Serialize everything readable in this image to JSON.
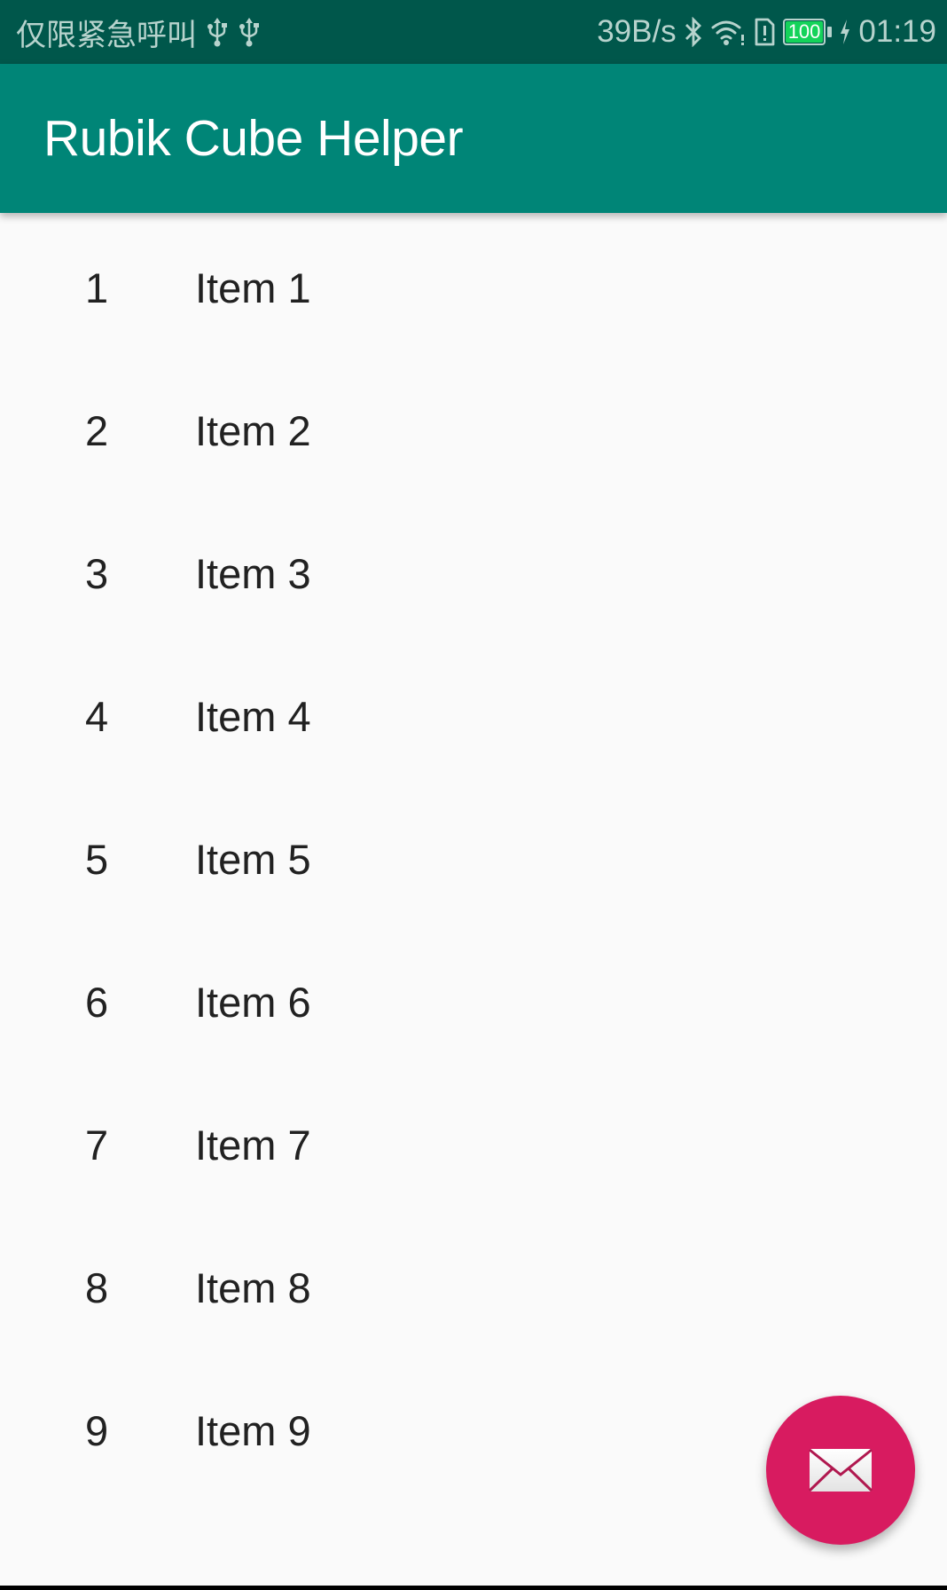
{
  "status_bar": {
    "carrier_text": "仅限紧急呼叫",
    "left_icons": [
      "usb-icon",
      "usb-icon"
    ],
    "network_speed": "39B/s",
    "right_icons": [
      "bluetooth-icon",
      "wifi-icon",
      "sim-alert-icon"
    ],
    "battery_level": "100",
    "charging": true,
    "time": "01:19"
  },
  "app_bar": {
    "title": "Rubik Cube Helper"
  },
  "list": {
    "items": [
      {
        "number": "1",
        "label": "Item 1"
      },
      {
        "number": "2",
        "label": "Item 2"
      },
      {
        "number": "3",
        "label": "Item 3"
      },
      {
        "number": "4",
        "label": "Item 4"
      },
      {
        "number": "5",
        "label": "Item 5"
      },
      {
        "number": "6",
        "label": "Item 6"
      },
      {
        "number": "7",
        "label": "Item 7"
      },
      {
        "number": "8",
        "label": "Item 8"
      },
      {
        "number": "9",
        "label": "Item 9"
      }
    ]
  },
  "fab": {
    "icon": "email-icon"
  },
  "colors": {
    "status_bar": "#00574b",
    "app_bar": "#008577",
    "accent": "#d81b60",
    "background": "#fafafa",
    "text": "#212121",
    "battery": "#14d35a"
  }
}
